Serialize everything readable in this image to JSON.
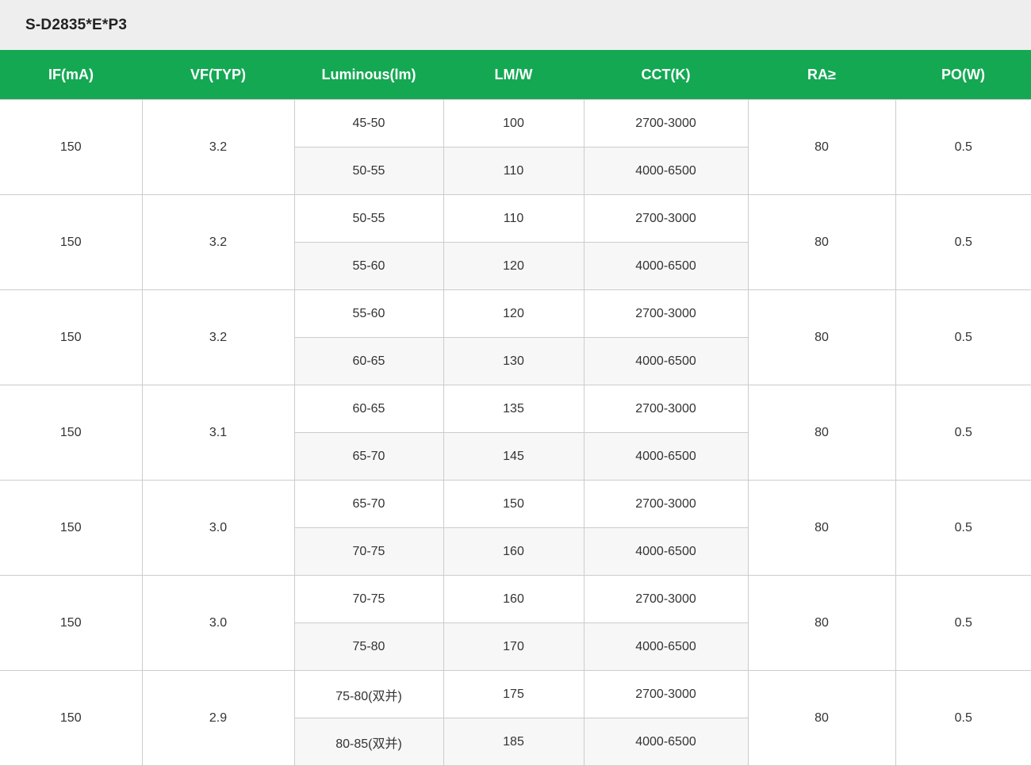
{
  "title": "S-D2835*E*P3",
  "colors": {
    "header_bg": "#14a853",
    "header_text": "#ffffff",
    "title_bar_bg": "#eeeeee",
    "border": "#cccccc",
    "alt_row_bg": "#f7f7f7"
  },
  "headers": [
    "IF(mA)",
    "VF(TYP)",
    "Luminous(lm)",
    "LM/W",
    "CCT(K)",
    "RA≥",
    "PO(W)"
  ],
  "groups": [
    {
      "if": "150",
      "vf": "3.2",
      "ra": "80",
      "po": "0.5",
      "rows": [
        {
          "lum": "45-50",
          "lmw": "100",
          "cct": "2700-3000"
        },
        {
          "lum": "50-55",
          "lmw": "110",
          "cct": "4000-6500"
        }
      ]
    },
    {
      "if": "150",
      "vf": "3.2",
      "ra": "80",
      "po": "0.5",
      "rows": [
        {
          "lum": "50-55",
          "lmw": "110",
          "cct": "2700-3000"
        },
        {
          "lum": "55-60",
          "lmw": "120",
          "cct": "4000-6500"
        }
      ]
    },
    {
      "if": "150",
      "vf": "3.2",
      "ra": "80",
      "po": "0.5",
      "rows": [
        {
          "lum": "55-60",
          "lmw": "120",
          "cct": "2700-3000"
        },
        {
          "lum": "60-65",
          "lmw": "130",
          "cct": "4000-6500"
        }
      ]
    },
    {
      "if": "150",
      "vf": "3.1",
      "ra": "80",
      "po": "0.5",
      "rows": [
        {
          "lum": "60-65",
          "lmw": "135",
          "cct": "2700-3000"
        },
        {
          "lum": "65-70",
          "lmw": "145",
          "cct": "4000-6500"
        }
      ]
    },
    {
      "if": "150",
      "vf": "3.0",
      "ra": "80",
      "po": "0.5",
      "rows": [
        {
          "lum": "65-70",
          "lmw": "150",
          "cct": "2700-3000"
        },
        {
          "lum": "70-75",
          "lmw": "160",
          "cct": "4000-6500"
        }
      ]
    },
    {
      "if": "150",
      "vf": "3.0",
      "ra": "80",
      "po": "0.5",
      "rows": [
        {
          "lum": "70-75",
          "lmw": "160",
          "cct": "2700-3000"
        },
        {
          "lum": "75-80",
          "lmw": "170",
          "cct": "4000-6500"
        }
      ]
    },
    {
      "if": "150",
      "vf": "2.9",
      "ra": "80",
      "po": "0.5",
      "rows": [
        {
          "lum": "75-80(双并)",
          "lmw": "175",
          "cct": "2700-3000"
        },
        {
          "lum": "80-85(双并)",
          "lmw": "185",
          "cct": "4000-6500"
        }
      ]
    }
  ]
}
